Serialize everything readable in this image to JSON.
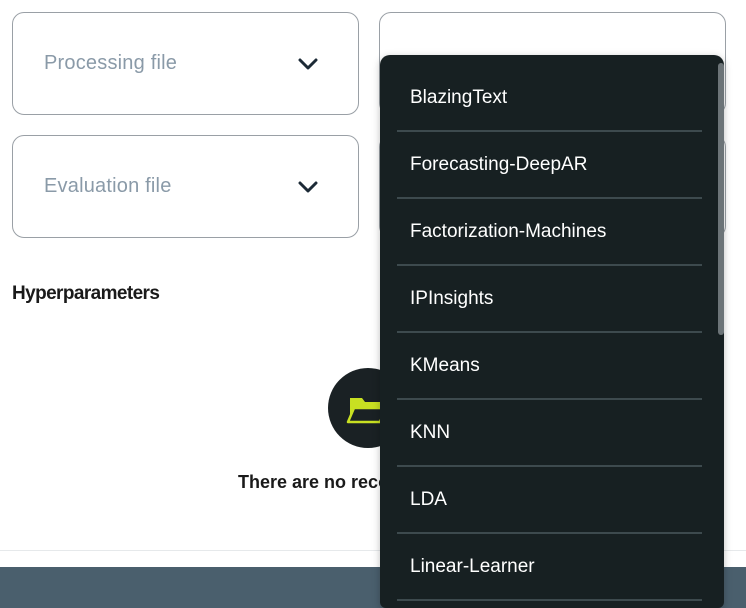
{
  "fields": {
    "processing_label": "Processing file",
    "evaluation_label": "Evaluation file"
  },
  "hyperparameters": {
    "heading": "Hyperparameters",
    "empty_text": "There are no reco"
  },
  "algorithm_dropdown": {
    "options": [
      "BlazingText",
      "Forecasting-DeepAR",
      "Factorization-Machines",
      "IPInsights",
      "KMeans",
      "KNN",
      "LDA",
      "Linear-Learner"
    ]
  },
  "icons": {
    "chevron": "chevron-down-icon",
    "empty_state": "folder-open-icon"
  },
  "colors": {
    "dropdown_bg": "#172022",
    "accent_folder": "#c8e022",
    "footer": "#4a5f6d",
    "label_gray": "#8a9aa8"
  }
}
